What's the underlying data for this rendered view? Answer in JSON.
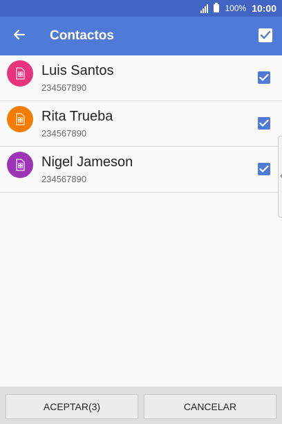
{
  "status_bar": {
    "battery_percent": "100%",
    "time": "10:00",
    "icons": [
      "signal-icon",
      "battery-icon"
    ]
  },
  "app_bar": {
    "title": "Contactos",
    "back_icon": "arrow-left-icon",
    "select_all_icon": "checkbox-checked-icon"
  },
  "contacts": [
    {
      "name": "Luis Santos",
      "number": "234567890",
      "avatar_color": "#e8337d",
      "avatar_icon": "sim-card-icon",
      "checked": true
    },
    {
      "name": "Rita Trueba",
      "number": "234567890",
      "avatar_color": "#f57c00",
      "avatar_icon": "sim-card-icon",
      "checked": true
    },
    {
      "name": "Nigel Jameson",
      "number": "234567890",
      "avatar_color": "#9c35b5",
      "avatar_icon": "sim-card-icon",
      "checked": true
    }
  ],
  "buttons": {
    "accept_label": "ACEPTAR(3)",
    "cancel_label": "CANCELAR"
  },
  "colors": {
    "status_bar": "#4265c4",
    "app_bar": "#4f7ad8",
    "checkbox": "#4f7ad8"
  }
}
